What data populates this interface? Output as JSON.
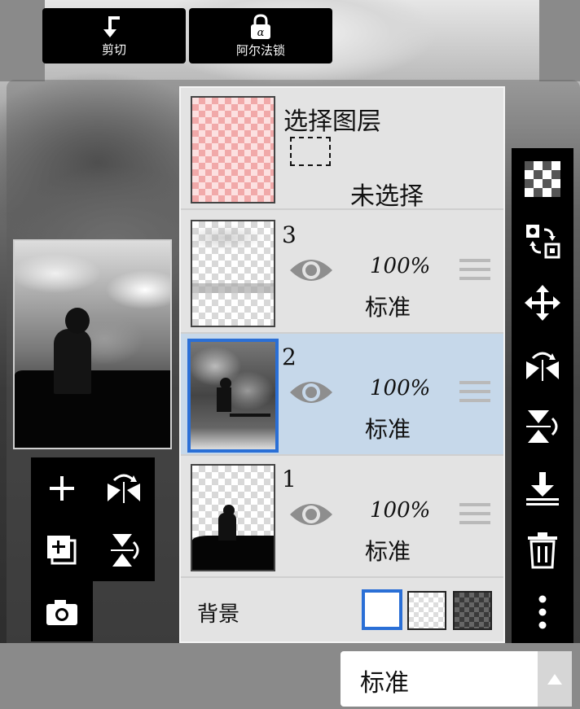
{
  "selection_layer": {
    "title": "选择图层",
    "status": "未选择"
  },
  "layers": [
    {
      "name": "3",
      "opacity": "100%",
      "blend": "标准"
    },
    {
      "name": "2",
      "opacity": "100%",
      "blend": "标准",
      "selected": true
    },
    {
      "name": "1",
      "opacity": "100%",
      "blend": "标准"
    }
  ],
  "background": {
    "label": "背景"
  },
  "bottom": {
    "clip_label": "剪切",
    "alpha_lock_label": "阿尔法锁",
    "blend_mode": "标准"
  },
  "icons": {
    "left_tools": [
      "add-layer-icon",
      "flip-horizontal-icon",
      "duplicate-layer-icon",
      "flip-vertical-icon",
      "camera-icon"
    ],
    "right_tools": [
      "transparency-icon",
      "swap-icon",
      "move-icon",
      "flip-horizontal-icon",
      "flip-vertical-icon",
      "merge-down-icon",
      "trash-icon",
      "more-icon"
    ]
  },
  "colors": {
    "selected_row": "#c6d8ea",
    "accent": "#2a6fd6",
    "toolbar": "#000000"
  }
}
